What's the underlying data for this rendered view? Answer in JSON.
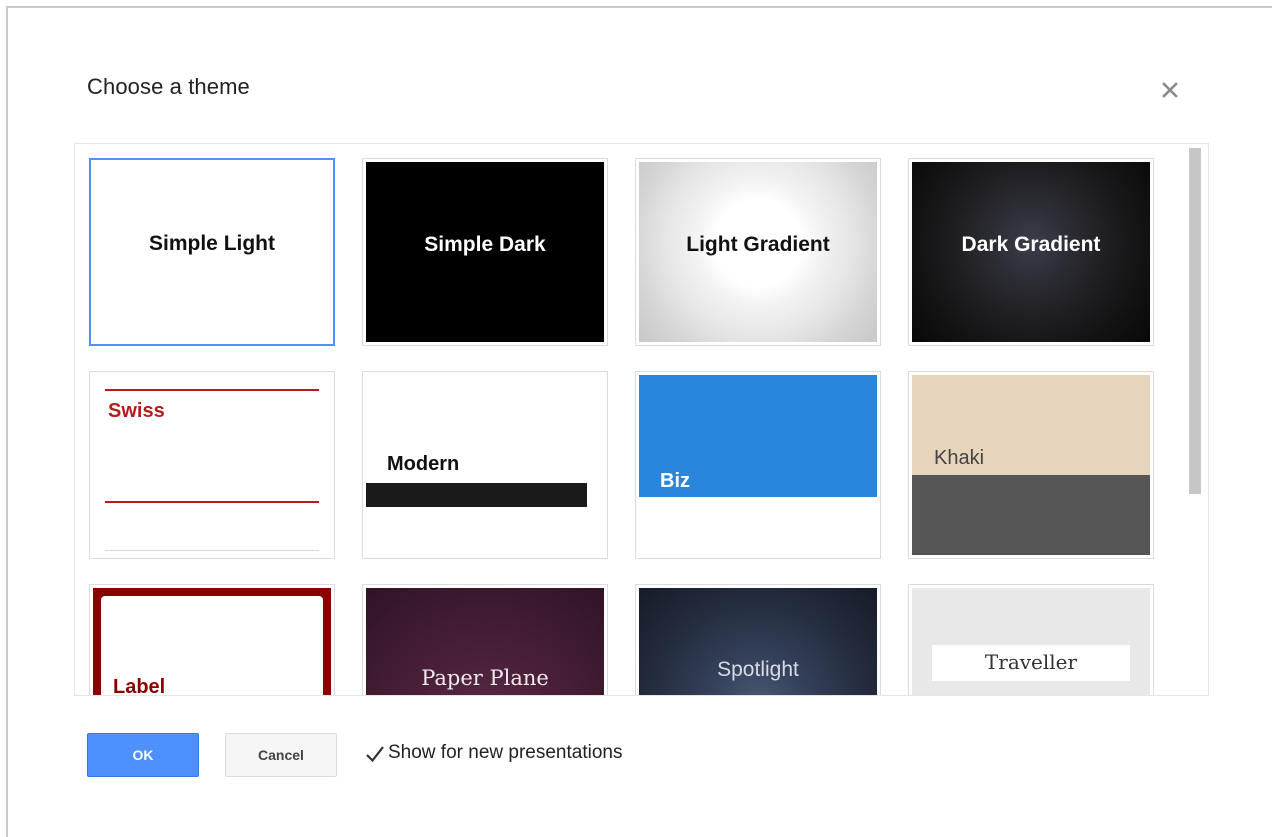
{
  "dialog": {
    "title": "Choose a theme",
    "close_icon": "close-icon",
    "ok_label": "OK",
    "cancel_label": "Cancel",
    "show_checkbox": {
      "label": "Show for new presentations",
      "checked": true
    }
  },
  "themes": [
    {
      "name": "Simple Light",
      "selected": true
    },
    {
      "name": "Simple Dark"
    },
    {
      "name": "Light Gradient"
    },
    {
      "name": "Dark Gradient"
    },
    {
      "name": "Swiss"
    },
    {
      "name": "Modern"
    },
    {
      "name": "Biz"
    },
    {
      "name": "Khaki"
    },
    {
      "name": "Label"
    },
    {
      "name": "Paper Plane"
    },
    {
      "name": "Spotlight"
    },
    {
      "name": "Traveller"
    }
  ],
  "colors": {
    "accent": "#4d90fe",
    "swiss_red": "#b71c1c",
    "biz_blue": "#2a86db",
    "khaki_tan": "#e6d5bc",
    "khaki_gray": "#555555",
    "label_red": "#8b0000",
    "paper_plane": "#4a2038",
    "spotlight": "#2c3645"
  }
}
